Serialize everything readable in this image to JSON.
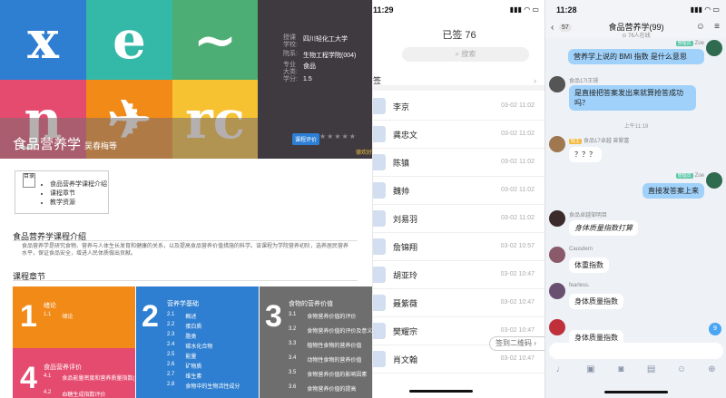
{
  "course_page": {
    "colors": [
      "#2e7fd1",
      "#34b8a8",
      "#4cae74",
      "#e54b6f",
      "#f28a17",
      "#f6c232"
    ],
    "hero_glyphs": [
      "x",
      "e",
      "~",
      "ɲ",
      "✈",
      "rc"
    ],
    "info_rows": [
      {
        "k": "授课学校:",
        "v": "四川轻化工大学"
      },
      {
        "k": "院系:",
        "v": "生物工程学院(004)"
      },
      {
        "k": "专业大类:",
        "v": "食品"
      },
      {
        "k": "学分:",
        "v": "1.5"
      }
    ],
    "title": "食品营养学",
    "teachers": "吴春梅等",
    "tag": "课程评价",
    "stars": "★★★★★",
    "score": "德欢好",
    "toc_label": "目录",
    "toc_items": [
      "食品营养学课程介绍",
      "课程章节",
      "教学资源"
    ],
    "intro_heading": "食品营养学课程介绍",
    "intro_text": "食品营养学是研究食物、营养与人体生长发育和健康的关系，以及提高食品营养价值措施的科学。该课程为学院营养初阶，选养居民营养水平，保证食品安全，增进人民体质做出贡献。",
    "chapters_heading": "课程章节",
    "chapters": [
      {
        "num": "1",
        "title": "绪论",
        "items": [
          {
            "n": "1.1",
            "t": "绪论"
          }
        ]
      },
      {
        "num": "2",
        "title": "营养学基础",
        "items": [
          {
            "n": "2.1",
            "t": "概述"
          },
          {
            "n": "2.2",
            "t": "蛋白质"
          },
          {
            "n": "2.3",
            "t": "脂类"
          },
          {
            "n": "2.4",
            "t": "碳水化合物"
          },
          {
            "n": "2.5",
            "t": "能量"
          },
          {
            "n": "2.6",
            "t": "矿物质"
          },
          {
            "n": "2.7",
            "t": "维生素"
          },
          {
            "n": "2.8",
            "t": "食物中的生物活性成分"
          }
        ]
      },
      {
        "num": "3",
        "title": "食物的营养价值",
        "items": [
          {
            "n": "3.1",
            "t": "食物营养价值的评价"
          },
          {
            "n": "3.2",
            "t": "食物营养价值的评价及意义"
          },
          {
            "n": "3.3",
            "t": "植物性食物的营养价值"
          },
          {
            "n": "3.4",
            "t": "动物性食物的营养价值"
          },
          {
            "n": "3.5",
            "t": "食物营养价值的影响因素"
          },
          {
            "n": "3.6",
            "t": "食物营养价值的提高"
          }
        ]
      },
      {
        "num": "4",
        "title": "食品营养评价",
        "items": [
          {
            "n": "4.1",
            "t": "食品能量密度和营养质量指数(评价)"
          },
          {
            "n": "4.2",
            "t": "血糖生成指数评价"
          }
        ]
      }
    ]
  },
  "signin": {
    "time": "11:29",
    "title": "已签 76",
    "search_placeholder": "搜索",
    "tab": "签",
    "rows": [
      {
        "name": "李京",
        "time": "03-02 11:02"
      },
      {
        "name": "龚忠文",
        "time": "03-02 11:02"
      },
      {
        "name": "陈镇",
        "time": "03-02 11:02"
      },
      {
        "name": "魏帅",
        "time": "03-02 11:02"
      },
      {
        "name": "刘易羽",
        "time": "03-02 11:02"
      },
      {
        "name": "詹锦翔",
        "time": "03-02 10:57"
      },
      {
        "name": "胡亚玲",
        "time": "03-02 10:47"
      },
      {
        "name": "聂紫薇",
        "time": "03-02 10:47"
      },
      {
        "name": "樊耀宗",
        "time": "03-02 10:47"
      },
      {
        "name": "肖文翰",
        "time": "03-02 10:47"
      }
    ],
    "qr_label": "签到二维码 ›"
  },
  "chat": {
    "time": "11:28",
    "back_count": "57",
    "group_name": "食品营养学(99)",
    "online": "⊙ 76人在线",
    "messages": [
      {
        "side": "me",
        "sender": "Zoe",
        "role": "管理员",
        "text": "营养学上说的 BMI 指数 是什么意思"
      },
      {
        "side": "other",
        "sender": "食品17I王璟",
        "text": "是直接把答案发出来就算抢答成功吗？"
      },
      {
        "side": "time",
        "text": "上午11:19"
      },
      {
        "side": "other",
        "sender": "食品17卓越 曾繁富",
        "role": "班主",
        "text": "？？？"
      },
      {
        "side": "me",
        "sender": "Zoe",
        "role": "管理员",
        "text": "直接发答案上来"
      },
      {
        "side": "other",
        "sender": "食品卓越邹明目",
        "text": "身体质量指数打算",
        "hand": true
      },
      {
        "side": "other",
        "sender": "Causdern",
        "text": "体重指数"
      },
      {
        "side": "other",
        "sender": "fearless.",
        "text": "身体质量指数"
      },
      {
        "side": "other",
        "sender": "",
        "text": "身体质量指数"
      }
    ],
    "unread": "9"
  }
}
